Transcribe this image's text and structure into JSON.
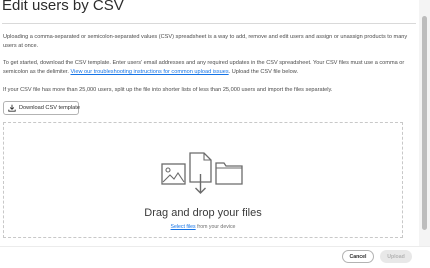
{
  "dialog": {
    "title": "Edit users by CSV",
    "intro": "Uploading a comma-separated or semicolon-separated values (CSV) spreadsheet is a way to add, remove and edit users and assign or unassign products to many users at once.",
    "instructions_before_link": "To get started, download the CSV template. Enter users' email addresses and any required updates in the CSV spreadsheet. Your CSV files must use a comma or semicolon as the delimiter.",
    "troubleshooting_link": "View our troubleshooting instructions for common upload issues",
    "instructions_after_link": ". Upload the CSV file below.",
    "limit_note": "If your CSV file has more than 25,000 users, split up the file into shorter lists of less than 25,000 users and import the files separately.",
    "download_button": {
      "label": "Download CSV template",
      "icon": "download-icon"
    },
    "dropzone": {
      "icons": [
        "image-file-icon",
        "document-upload-icon",
        "folder-icon"
      ],
      "title": "Drag and drop your files",
      "select_link": "Select files",
      "select_suffix": " from your device"
    }
  },
  "footer": {
    "cancel_label": "Cancel",
    "upload_label": "Upload",
    "upload_enabled": false
  },
  "colors": {
    "link": "#1473e6",
    "text": "#2c2c2c",
    "disabled_bg": "#e8e8e8"
  }
}
